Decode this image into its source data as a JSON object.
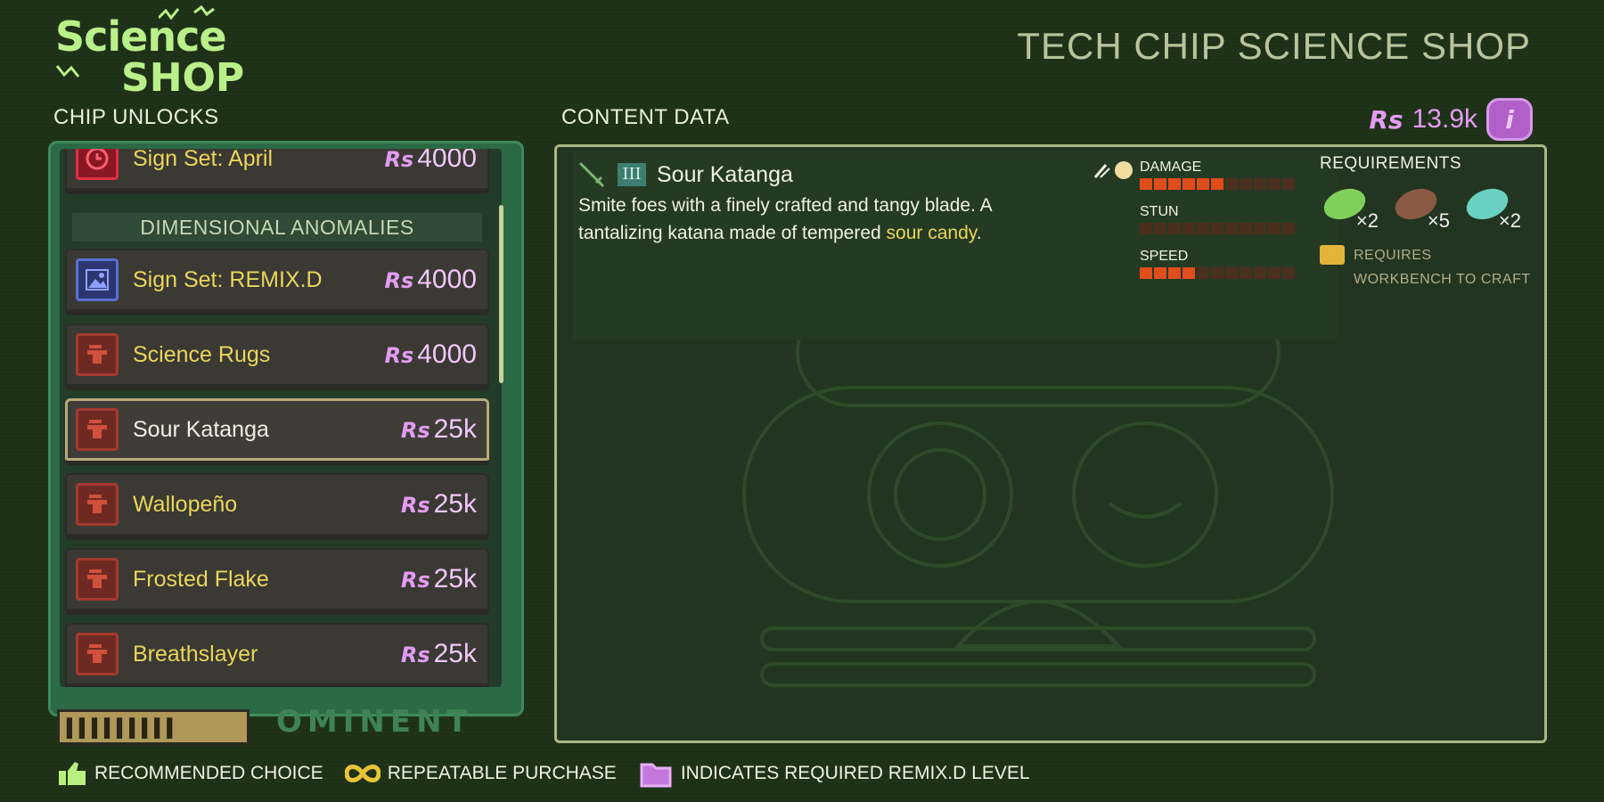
{
  "logo": {
    "line1": "Science",
    "line2": "SHOP"
  },
  "shop_title": "TECH CHIP SCIENCE SHOP",
  "left_label": "CHIP UNLOCKS",
  "content_label": "CONTENT DATA",
  "currency": {
    "symbol": "Rs",
    "amount": "13.9k",
    "badge": "i"
  },
  "category_header": "DIMENSIONAL ANOMALIES",
  "chips": [
    {
      "name": "Sign Set: April",
      "price": "4000",
      "icon": "calendar-icon"
    },
    {
      "name": "Sign Set: REMIX.D",
      "price": "4000",
      "icon": "picture-icon"
    },
    {
      "name": "Science Rugs",
      "price": "4000",
      "icon": "workbench-icon"
    },
    {
      "name": "Sour Katanga",
      "price": "25k",
      "icon": "workbench-icon",
      "selected": true
    },
    {
      "name": "Wallopeño",
      "price": "25k",
      "icon": "workbench-icon"
    },
    {
      "name": "Frosted Flake",
      "price": "25k",
      "icon": "workbench-icon"
    },
    {
      "name": "Breathslayer",
      "price": "25k",
      "icon": "workbench-icon"
    }
  ],
  "brand": "OMINENT",
  "item": {
    "tier": "III",
    "name": "Sour Katanga",
    "desc_main": "Smite foes with a finely crafted and tangy blade. A tantalizing katana made of tempered ",
    "desc_highlight": "sour candy",
    "desc_end": ".",
    "stats": [
      {
        "label": "DAMAGE",
        "level": 0.55
      },
      {
        "label": "STUN",
        "level": 0.0
      },
      {
        "label": "SPEED",
        "level": 0.35
      }
    ],
    "requirements_title": "REQUIREMENTS",
    "requirements": [
      {
        "icon": "green-crystal-icon",
        "qty": "×2",
        "color": "#7fd05a"
      },
      {
        "icon": "brown-branch-icon",
        "qty": "×5",
        "color": "#8a5a44"
      },
      {
        "icon": "rainbow-slime-icon",
        "qty": "×2",
        "color": "#6ad0c0"
      }
    ],
    "workbench_text": "REQUIRES WORKBENCH TO CRAFT"
  },
  "legend": [
    {
      "icon": "thumbs-up-icon",
      "label": "RECOMMENDED CHOICE"
    },
    {
      "icon": "infinity-icon",
      "label": "REPEATABLE PURCHASE"
    },
    {
      "icon": "remix-folder-icon",
      "label": "INDICATES REQUIRED REMIX.D LEVEL"
    }
  ],
  "colors": {
    "accent_yellow": "#e9d65a",
    "currency_pink": "#e49cf2",
    "panel_green": "#2b6a45",
    "stat_orange": "#e04d1c"
  }
}
